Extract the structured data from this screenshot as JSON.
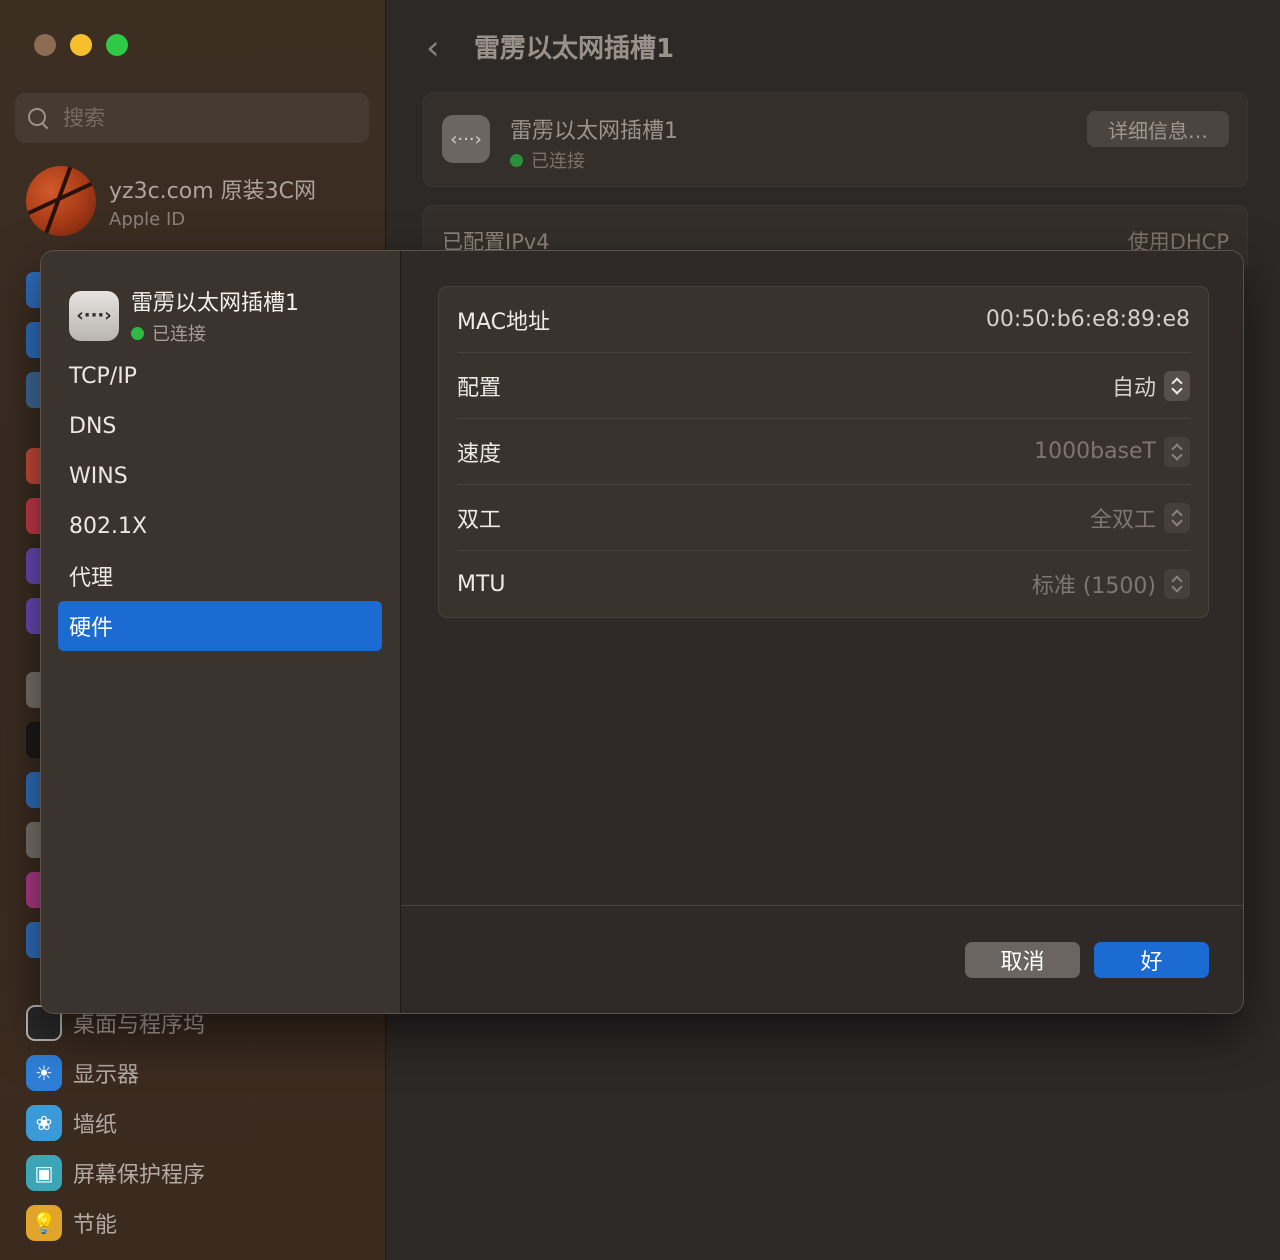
{
  "window": {
    "traffic_lights": {
      "close": "#8c6c52",
      "minimize": "#f5bf2e",
      "maximize": "#2ec947"
    },
    "search": {
      "placeholder": "搜索"
    },
    "account": {
      "name": "yz3c.com 原装3C网",
      "subtitle": "Apple ID"
    },
    "sidebar_bottom": [
      {
        "label": "桌面与程序坞",
        "icon": "dock-icon"
      },
      {
        "label": "显示器",
        "icon": "display-icon"
      },
      {
        "label": "墙纸",
        "icon": "wallpaper-icon"
      },
      {
        "label": "屏幕保护程序",
        "icon": "screensaver-icon"
      },
      {
        "label": "节能",
        "icon": "energy-icon"
      }
    ],
    "main": {
      "back_glyph": "‹",
      "title": "雷雳以太网插槽1",
      "service": {
        "icon_glyph": "‹···›",
        "name": "雷雳以太网插槽1",
        "status": "已连接",
        "details_button": "详细信息…"
      },
      "ipv4": {
        "label": "已配置IPv4",
        "value": "使用DHCP"
      }
    }
  },
  "sheet": {
    "header": {
      "icon_glyph": "‹···›",
      "name": "雷雳以太网插槽1",
      "status": "已连接"
    },
    "menu": [
      {
        "label": "TCP/IP",
        "active": false
      },
      {
        "label": "DNS",
        "active": false
      },
      {
        "label": "WINS",
        "active": false
      },
      {
        "label": "802.1X",
        "active": false
      },
      {
        "label": "代理",
        "active": false
      },
      {
        "label": "硬件",
        "active": true
      }
    ],
    "hardware": {
      "mac": {
        "label": "MAC地址",
        "value": "00:50:b6:e8:89:e8"
      },
      "config": {
        "label": "配置",
        "value": "自动"
      },
      "speed": {
        "label": "速度",
        "value": "1000baseT"
      },
      "duplex": {
        "label": "双工",
        "value": "全双工"
      },
      "mtu": {
        "label": "MTU",
        "value": "标准 (1500)"
      }
    },
    "buttons": {
      "cancel": "取消",
      "ok": "好"
    },
    "colors": {
      "accent": "#1b6bd3",
      "connected": "#2fb945"
    }
  }
}
